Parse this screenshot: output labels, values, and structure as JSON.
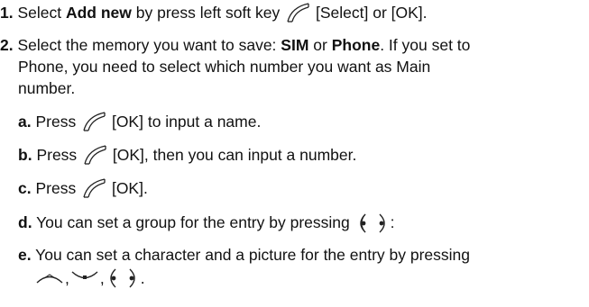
{
  "steps": [
    {
      "num": "1.",
      "t1": "Select ",
      "b1": "Add new",
      "t2": " by press left soft key ",
      "t3": " [Select] or [OK]."
    },
    {
      "num": "2.",
      "t1": "Select the memory you want to save: ",
      "b1": "SIM",
      "t2": " or ",
      "b2": "Phone",
      "t3": ". If you set to",
      "line2": "Phone, you need to select which number you want as Main",
      "line3": "number."
    }
  ],
  "substeps": [
    {
      "letter": "a.",
      "t1": "Press ",
      "t2": " [OK] to input a name."
    },
    {
      "letter": "b.",
      "t1": "Press ",
      "t2": " [OK], then you can input a number."
    },
    {
      "letter": "c.",
      "t1": "Press ",
      "t2": " [OK]."
    },
    {
      "letter": "d.",
      "t1": "You can set a group for the entry by pressing ",
      "comma": ",",
      "t2": ":"
    },
    {
      "letter": "e.",
      "t1": "You can set a character and a picture for the entry by pressing",
      "sep1": ",",
      "sep2": ",",
      "comma": ",",
      "end": "."
    }
  ],
  "icons": {
    "soft_key": "left-soft-key-icon",
    "nav_left": "nav-left-icon",
    "nav_right": "nav-right-icon",
    "nav_up": "nav-up-icon",
    "nav_down": "nav-down-icon"
  },
  "colors": {
    "text": "#111111",
    "icon_stroke": "#222222"
  }
}
